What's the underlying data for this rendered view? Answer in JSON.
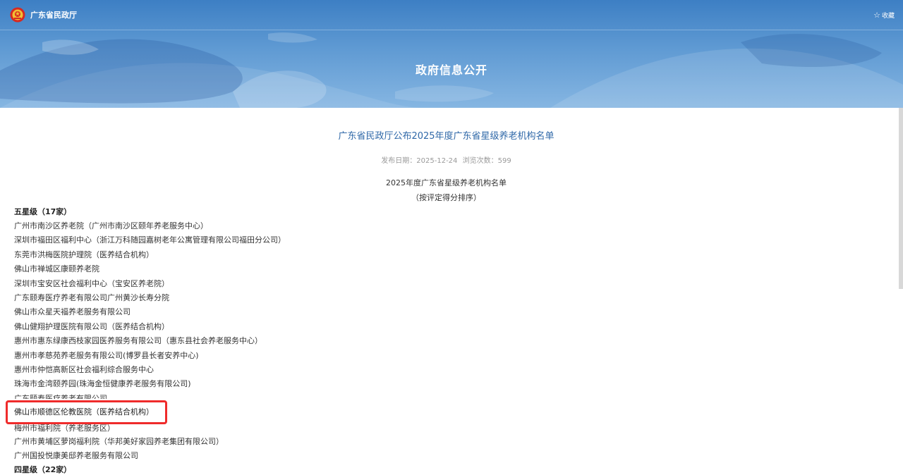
{
  "header": {
    "site_name": "广东省民政厅",
    "favorite_label": "收藏",
    "banner_title": "政府信息公开"
  },
  "article": {
    "title": "广东省民政厅公布2025年度广东省星级养老机构名单",
    "publish_date": "发布日期：2025-12-24",
    "views": "浏览次数：599",
    "subtitle": "2025年度广东省星级养老机构名单",
    "note": "（按评定得分排序）"
  },
  "sections": [
    {
      "heading": "五星级（17家）",
      "items": [
        "广州市南沙区养老院（广州市南沙区颐年养老服务中心）",
        "深圳市福田区福利中心（浙江万科随园嘉树老年公寓管理有限公司福田分公司）",
        "东莞市洪梅医院护理院（医养结合机构）",
        "佛山市禅城区康颐养老院",
        "深圳市宝安区社会福利中心（宝安区养老院）",
        "广东颐寿医疗养老有限公司广州黄沙长寿分院",
        "佛山市众星天福养老服务有限公司",
        "佛山健翔护理医院有限公司（医养结合机构）",
        "惠州市惠东绿康西枝家园医养服务有限公司（惠东县社会养老服务中心）",
        "惠州市孝慈苑养老服务有限公司(博罗县长者安养中心)",
        "惠州市仲恺高新区社会福利综合服务中心",
        "珠海市金湾颐养园(珠海金恒健康养老服务有限公司)",
        "广东颐寿医疗养老有限公司",
        "佛山市顺德区伦教医院（医养结合机构）",
        "梅州市福利院（养老服务区）",
        "广州市黄埔区萝岗福利院（华邦美好家园养老集团有限公司）",
        "广州国投悦康美邸养老服务有限公司"
      ]
    },
    {
      "heading": "四星级（22家）"
    }
  ]
}
